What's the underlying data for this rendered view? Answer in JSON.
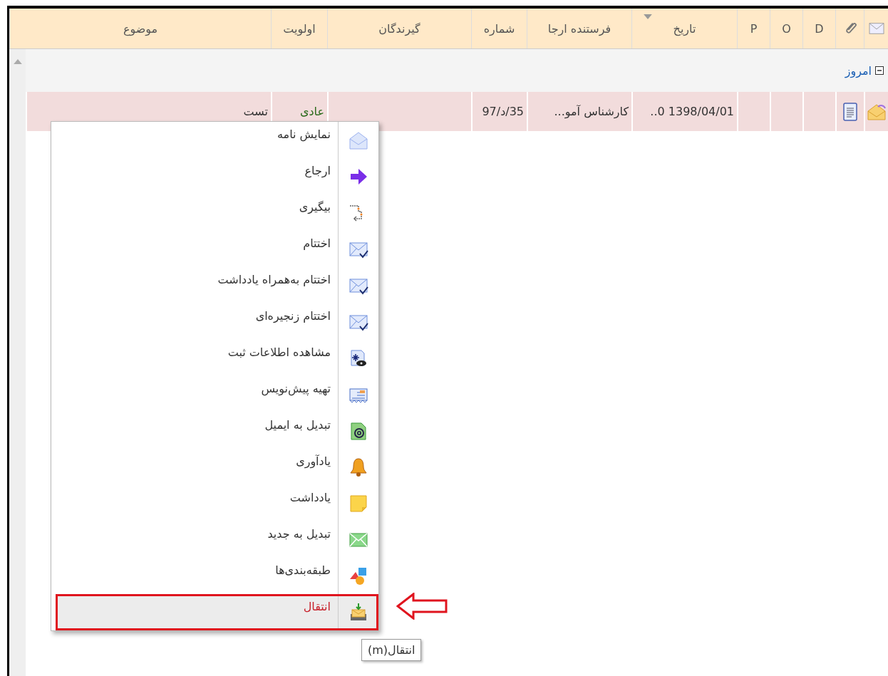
{
  "table": {
    "columns": [
      {
        "kind": "icon",
        "sorted": false
      },
      {
        "kind": "icon",
        "sorted": false
      },
      {
        "kind": "text",
        "label": "D",
        "sorted": false
      },
      {
        "kind": "text",
        "label": "O",
        "sorted": false
      },
      {
        "kind": "text",
        "label": "P",
        "sorted": false
      },
      {
        "kind": "text",
        "label": "تاریخ",
        "sorted": true
      },
      {
        "kind": "text",
        "label": "فرستنده ارجا",
        "sorted": false
      },
      {
        "kind": "text",
        "label": "شماره",
        "sorted": false
      },
      {
        "kind": "text",
        "label": "گیرندگان",
        "sorted": false
      },
      {
        "kind": "text",
        "label": "اولویت",
        "sorted": false
      },
      {
        "kind": "text",
        "label": "موضوع",
        "sorted": false
      }
    ],
    "group": {
      "label": "امروز",
      "expanded": true
    },
    "rows": [
      {
        "selected": true,
        "date": "1398/04/01 0..",
        "sender": "کارشناس آمو...",
        "number": "35/د/97",
        "priority": "عادی",
        "subject": "تست"
      }
    ]
  },
  "context_menu": {
    "items": [
      {
        "label": "نمایش نامه",
        "selected": false
      },
      {
        "label": "ارجاع",
        "selected": false
      },
      {
        "label": "بیگیری",
        "selected": false
      },
      {
        "label": "اختتام",
        "selected": false
      },
      {
        "label": "اختتام به‌همراه یادداشت",
        "selected": false
      },
      {
        "label": "اختتام زنجیره‌ای",
        "selected": false
      },
      {
        "label": "مشاهده اطلاعات ثبت",
        "selected": false
      },
      {
        "label": "تهیه پیش‌نویس",
        "selected": false
      },
      {
        "label": "تبدیل به ایمیل",
        "selected": false
      },
      {
        "label": "یادآوری",
        "selected": false
      },
      {
        "label": "یادداشت",
        "selected": false
      },
      {
        "label": "تبدیل به جدید",
        "selected": false
      },
      {
        "label": "طبقه‌بندی‌ها",
        "selected": false
      },
      {
        "label": "انتقال",
        "selected": true
      }
    ]
  },
  "tooltip": {
    "text": "انتقال(m)"
  }
}
